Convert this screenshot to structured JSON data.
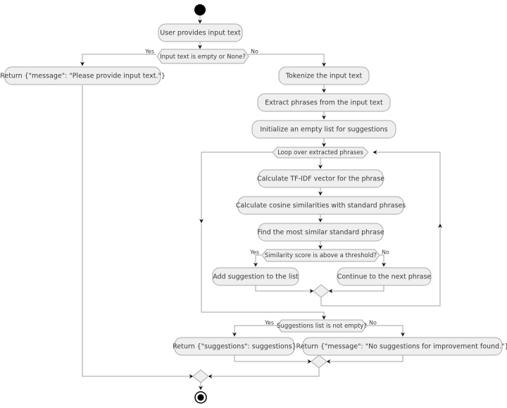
{
  "diagram": {
    "type": "uml-activity-diagram",
    "title": "Input text suggestion flow",
    "colors": {
      "node_fill": "#efefef",
      "node_stroke": "#a8a8a8",
      "edge": "#a0a0a0",
      "text": "#3a3a3a",
      "terminal": "#000000",
      "background": "#ffffff"
    },
    "nodes": {
      "start": {
        "kind": "initial-node",
        "label": ""
      },
      "user_input": {
        "kind": "action",
        "label": "User provides input text"
      },
      "empty_check": {
        "kind": "decision",
        "label": "Input text is empty or None?"
      },
      "return_please_provide": {
        "kind": "action",
        "label": "Return {\"message\": \"Please provide input text.\"}"
      },
      "tokenize": {
        "kind": "action",
        "label": "Tokenize the input text"
      },
      "extract_phrases": {
        "kind": "action",
        "label": "Extract phrases from the input text"
      },
      "init_list": {
        "kind": "action",
        "label": "Initialize an empty list for suggestions"
      },
      "loop": {
        "kind": "loop",
        "label": "Loop over extracted phrases"
      },
      "tfidf": {
        "kind": "action",
        "label": "Calculate TF-IDF vector for the phrase"
      },
      "cosine": {
        "kind": "action",
        "label": "Calculate cosine similarities with standard phrases"
      },
      "most_similar": {
        "kind": "action",
        "label": "Find the most similar standard phrase"
      },
      "threshold_check": {
        "kind": "decision",
        "label": "Similarity score is above a threshold?"
      },
      "add_suggestion": {
        "kind": "action",
        "label": "Add suggestion to the list"
      },
      "continue_next": {
        "kind": "action",
        "label": "Continue to the next phrase"
      },
      "merge_threshold": {
        "kind": "merge",
        "label": ""
      },
      "suggestions_check": {
        "kind": "decision",
        "label": "Suggestions list is not empty?"
      },
      "return_suggestions": {
        "kind": "action",
        "label": "Return {\"suggestions\": suggestions}"
      },
      "return_no_suggestions": {
        "kind": "action",
        "label": "Return {\"message\": \"No suggestions for improvement found.\"}"
      },
      "merge_results": {
        "kind": "merge",
        "label": ""
      },
      "merge_final": {
        "kind": "merge",
        "label": ""
      },
      "end": {
        "kind": "final-node",
        "label": ""
      }
    },
    "guards": {
      "empty_yes": "Yes",
      "empty_no": "No",
      "threshold_yes": "Yes",
      "threshold_no": "No",
      "suggestions_yes": "Yes",
      "suggestions_no": "No"
    },
    "edges": [
      {
        "from": "start",
        "to": "user_input",
        "guard": ""
      },
      {
        "from": "user_input",
        "to": "empty_check",
        "guard": ""
      },
      {
        "from": "empty_check",
        "to": "return_please_provide",
        "guard": "Yes"
      },
      {
        "from": "empty_check",
        "to": "tokenize",
        "guard": "No"
      },
      {
        "from": "return_please_provide",
        "to": "merge_final",
        "guard": ""
      },
      {
        "from": "tokenize",
        "to": "extract_phrases",
        "guard": ""
      },
      {
        "from": "extract_phrases",
        "to": "init_list",
        "guard": ""
      },
      {
        "from": "init_list",
        "to": "loop",
        "guard": ""
      },
      {
        "from": "loop",
        "to": "tfidf",
        "guard": ""
      },
      {
        "from": "tfidf",
        "to": "cosine",
        "guard": ""
      },
      {
        "from": "cosine",
        "to": "most_similar",
        "guard": ""
      },
      {
        "from": "most_similar",
        "to": "threshold_check",
        "guard": ""
      },
      {
        "from": "threshold_check",
        "to": "add_suggestion",
        "guard": "Yes"
      },
      {
        "from": "threshold_check",
        "to": "continue_next",
        "guard": "No"
      },
      {
        "from": "add_suggestion",
        "to": "merge_threshold",
        "guard": ""
      },
      {
        "from": "continue_next",
        "to": "merge_threshold",
        "guard": ""
      },
      {
        "from": "merge_threshold",
        "to": "loop",
        "guard": ""
      },
      {
        "from": "loop",
        "to": "suggestions_check",
        "guard": ""
      },
      {
        "from": "suggestions_check",
        "to": "return_suggestions",
        "guard": "Yes"
      },
      {
        "from": "suggestions_check",
        "to": "return_no_suggestions",
        "guard": "No"
      },
      {
        "from": "return_suggestions",
        "to": "merge_results",
        "guard": ""
      },
      {
        "from": "return_no_suggestions",
        "to": "merge_results",
        "guard": ""
      },
      {
        "from": "merge_results",
        "to": "merge_final",
        "guard": ""
      },
      {
        "from": "merge_final",
        "to": "end",
        "guard": ""
      }
    ]
  }
}
